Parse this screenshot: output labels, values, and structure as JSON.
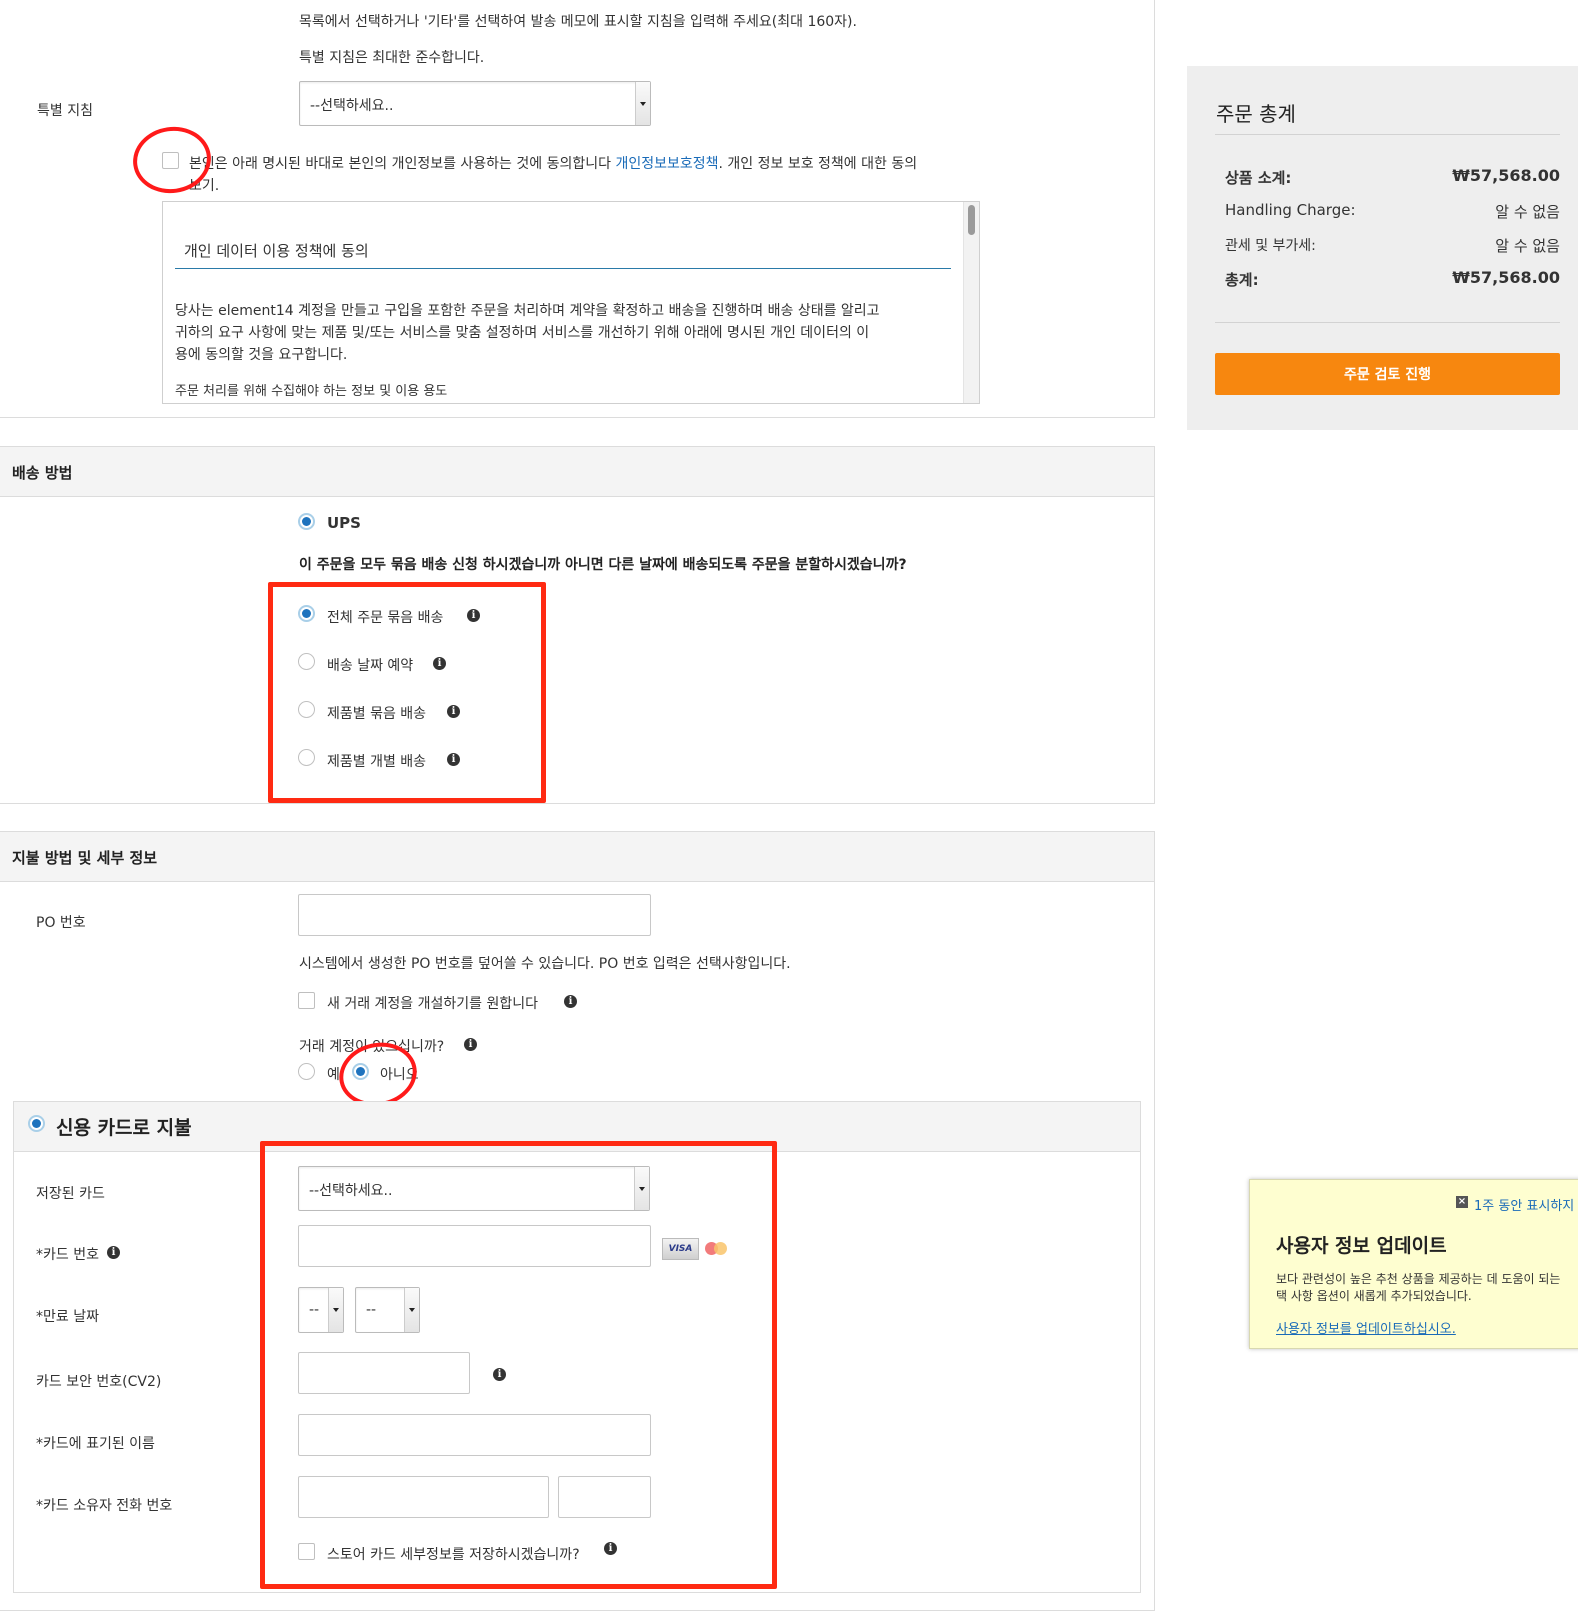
{
  "top": {
    "instruction_line1": "목록에서 선택하거나 '기타'를 선택하여 발송 메모에 표시할 지침을 입력해 주세요(최대 160자).",
    "instruction_line2": "특별 지침은 최대한 준수합니다.",
    "special_label": "특별 지침",
    "special_select": "--선택하세요..",
    "consent_text_a": "본인은 아래 명시된 바대로 본인의 개인정보를 사용하는 것에 동의합니다 ",
    "consent_link": "개인정보보호정책",
    "consent_text_b": ". 개인 정보 보호 정책에 대한 동의",
    "consent_text_c": "보기.",
    "policy_title": "개인 데이터 이용 정책에 동의",
    "policy_body_1": "당사는 element14 계정을 만들고 구입을 포함한 주문을 처리하며 계약을 확정하고 배송을 진행하며 배송 상태를 알리고",
    "policy_body_2": "귀하의 요구 사항에 맞는 제품 및/또는 서비스를 맞춤 설정하며 서비스를 개선하기 위해 아래에 명시된 개인 데이터의 이",
    "policy_body_3": "용에 동의할 것을 요구합니다.",
    "policy_sub": "주문 처리를 위해 수집해야 하는 정보 및 이용 용도"
  },
  "shipping": {
    "title": "배송 방법",
    "carrier": "UPS",
    "question": "이 주문을 모두 묶음 배송 신청 하시겠습니까 아니면 다른 날짜에 배송되도록 주문을 분할하시겠습니까?",
    "options": [
      "전체 주문 묶음 배송",
      "배송 날짜 예약",
      "제품별 묶음 배송",
      "제품별 개별 배송"
    ]
  },
  "payment": {
    "title": "지불 방법 및 세부 정보",
    "po_label": "PO 번호",
    "po_hint": "시스템에서 생성한 PO 번호를 덮어쓸 수 있습니다. PO 번호 입력은 선택사항입니다.",
    "new_account": "새 거래 계정을 개설하기를 원합니다",
    "account_question": "거래 계정이 있으십니까?",
    "yes": "예",
    "no": "아니오",
    "credit_title": "신용 카드로 지불",
    "saved_card_label": "저장된 카드",
    "saved_card_select": "--선택하세요..",
    "card_number_label": "*카드 번호",
    "visa": "VISA",
    "expiry_label": "*만료 날짜",
    "expiry_month": "--",
    "expiry_year": "--",
    "cvv_label": "카드 보안 번호(CV2)",
    "name_label": "*카드에 표기된 이름",
    "phone_label": "*카드 소유자 전화 번호",
    "store_card": "스토어 카드 세부정보를 저장하시겠습니까?"
  },
  "summary": {
    "title": "주문 총계",
    "rows": [
      {
        "label": "상품 소계:",
        "value": "₩57,568.00"
      },
      {
        "label": "Handling Charge:",
        "value": "알 수 없음"
      },
      {
        "label": "관세 및 부가세:",
        "value": "알 수 없음"
      },
      {
        "label": "총계:",
        "value": "₩57,568.00"
      }
    ],
    "button": "주문 검토 진행"
  },
  "popup": {
    "dismiss": "1주 동안 표시하지",
    "title": "사용자 정보 업데이트",
    "body_1": "보다 관련성이 높은 추천 상품을 제공하는 데 도움이 되는",
    "body_2": "택 사항 옵션이 새롭게 추가되었습니다.",
    "link": "사용자 정보를 업데이트하십시오."
  },
  "colors": {
    "accent_blue": "#1e73be",
    "button_orange": "#f7870f",
    "annotation_red": "#ff2a12",
    "popup_bg": "#fefed0"
  }
}
